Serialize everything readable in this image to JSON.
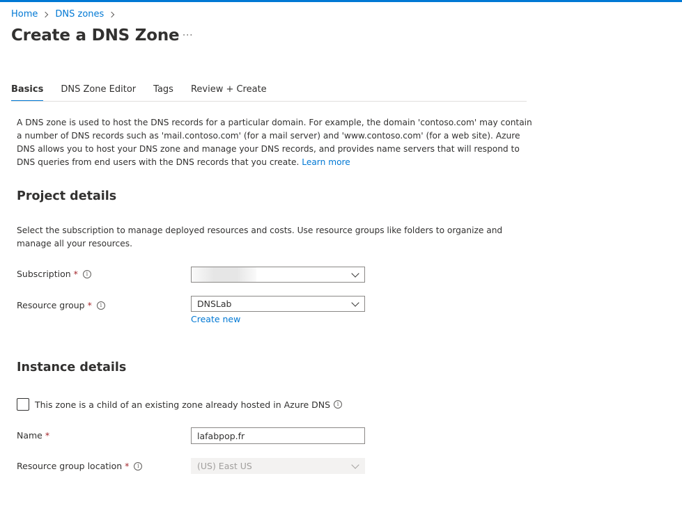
{
  "breadcrumb": {
    "home": "Home",
    "dns_zones": "DNS zones"
  },
  "page": {
    "title": "Create a DNS Zone",
    "more": "···"
  },
  "tabs": [
    {
      "label": "Basics",
      "active": true
    },
    {
      "label": "DNS Zone Editor",
      "active": false
    },
    {
      "label": "Tags",
      "active": false
    },
    {
      "label": "Review + Create",
      "active": false
    }
  ],
  "intro": {
    "text": "A DNS zone is used to host the DNS records for a particular domain. For example, the domain 'contoso.com' may contain a number of DNS records such as 'mail.contoso.com' (for a mail server) and 'www.contoso.com' (for a web site). Azure DNS allows you to host your DNS zone and manage your DNS records, and provides name servers that will respond to DNS queries from end users with the DNS records that you create.",
    "learn_more": "Learn more"
  },
  "project_details": {
    "title": "Project details",
    "description": "Select the subscription to manage deployed resources and costs. Use resource groups like folders to organize and manage all your resources.",
    "subscription": {
      "label": "Subscription",
      "required": "*",
      "value": ""
    },
    "resource_group": {
      "label": "Resource group",
      "required": "*",
      "value": "DNSLab",
      "create_new": "Create new"
    }
  },
  "instance_details": {
    "title": "Instance details",
    "child_zone": {
      "label": "This zone is a child of an existing zone already hosted in Azure DNS",
      "checked": false
    },
    "name": {
      "label": "Name",
      "required": "*",
      "value": "lafabpop.fr"
    },
    "location": {
      "label": "Resource group location",
      "required": "*",
      "value": "(US) East US"
    }
  },
  "icons": {
    "info": "info-icon",
    "chevron_down": "chevron-down-icon",
    "breadcrumb_separator": "chevron-right-icon"
  },
  "colors": {
    "accent": "#0078d4",
    "required": "#a4262c",
    "text": "#323130",
    "disabled_bg": "#f3f2f1"
  }
}
